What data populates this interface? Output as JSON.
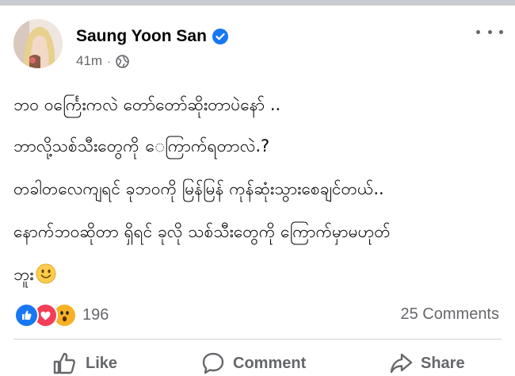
{
  "post": {
    "author": "Saung Yoon San",
    "time": "41m",
    "separator": "·",
    "lines": [
      "ဘဝ ဝင်္ကြေးကလဲ တော်တော်ဆိုးတာပဲနော် ..",
      "ဘာလို့သစ်သီးတွေကို ေကြာက်ရတာလဲ.?",
      "တခါတလေကျရင် ခုဘဝကို မြန်မြန် ကုန်ဆုံးသွားစေချင်တယ်..",
      "နောက်ဘဝဆိုတာ ရှိရင် ခုလို သစ်သီးတွေကို ကြောက်မှာမဟုတ်",
      "ဘူး"
    ],
    "reaction_count": "196",
    "comments": "25 Comments"
  },
  "actions": {
    "like": "Like",
    "comment": "Comment",
    "share": "Share"
  },
  "icons": [
    "verified-badge-icon",
    "globe-icon",
    "more-options-icon",
    "like-reaction-icon",
    "love-reaction-icon",
    "wow-reaction-icon",
    "smiley-emoji-icon",
    "thumbs-up-icon",
    "comment-bubble-icon",
    "share-arrow-icon"
  ],
  "colors": {
    "brand_blue": "#1877f2",
    "secondary_text": "#65676b",
    "divider": "#ced0d4"
  }
}
